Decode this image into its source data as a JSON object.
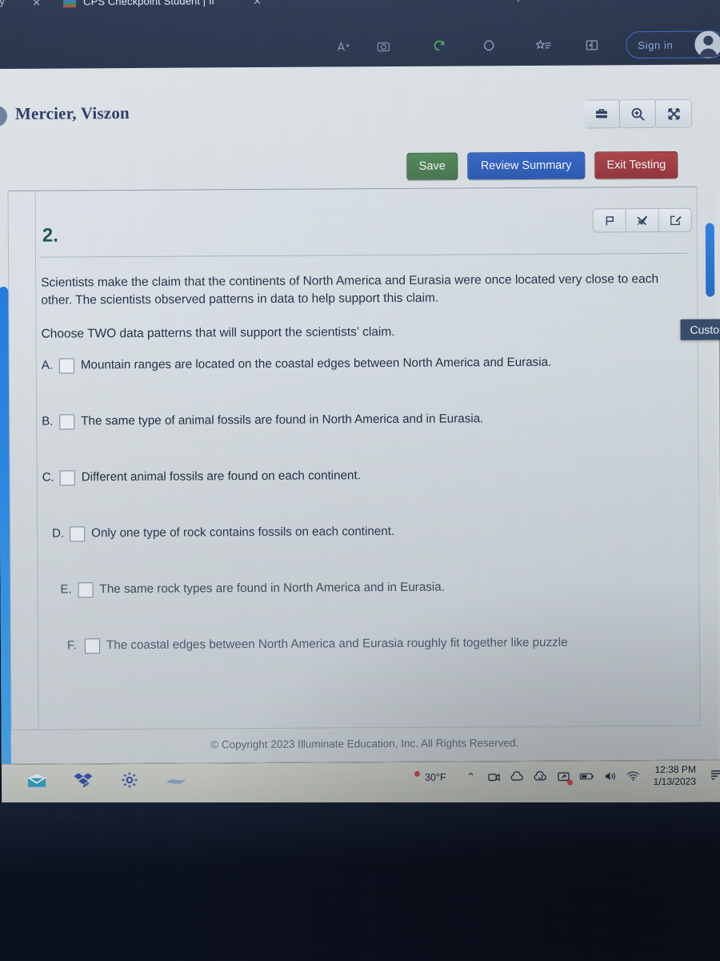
{
  "browser": {
    "tab_left_partial": "ty",
    "tab_left_close": "✕",
    "active_tab_title": "CPS Checkpoint Student | Il",
    "active_tab_close": "✕",
    "new_tab": "+",
    "favicon_name": "illuminate-favicon",
    "toolbar_icons": [
      {
        "name": "read-aloud-icon",
        "glyph": "A"
      },
      {
        "name": "collections-photo-icon",
        "glyph": ""
      },
      {
        "name": "refresh-green-icon",
        "glyph": ""
      },
      {
        "name": "browser-essentials-icon",
        "glyph": ""
      },
      {
        "name": "favorites-list-icon",
        "glyph": ""
      },
      {
        "name": "split-screen-icon",
        "glyph": ""
      }
    ],
    "signin_label": "Sign in",
    "profile_name": "profile-avatar"
  },
  "app": {
    "back_icon": "‹",
    "student_name": "Mercier, Viszon",
    "header_buttons": [
      {
        "name": "toolbox-button",
        "title": "Tools"
      },
      {
        "name": "zoom-in-button",
        "title": "Zoom In"
      },
      {
        "name": "fullscreen-button",
        "title": "Full Screen"
      }
    ],
    "actions": {
      "save_label": "Save",
      "review_label": "Review Summary",
      "exit_label": "Exit Testing",
      "save_color": "#44764a",
      "review_color": "#2a5cba",
      "exit_color": "#9c3539"
    }
  },
  "question": {
    "number": "2.",
    "number_color": "#1d5149",
    "toolbar_buttons": [
      {
        "name": "flag-question-button",
        "title": "Flag"
      },
      {
        "name": "eliminate-choice-button",
        "title": "Eliminate Choice"
      },
      {
        "name": "notepad-button",
        "title": "Notepad"
      }
    ],
    "stem_paragraph_1": "Scientists make the claim that the continents of North America and Eurasia were once located very close to each other. The scientists observed patterns in data to help support this claim.",
    "stem_paragraph_2": "Choose TWO data patterns that will support the scientists’ claim.",
    "options": [
      {
        "letter": "A.",
        "text": "Mountain ranges are located on the coastal edges between North America and Eurasia.",
        "checked": false
      },
      {
        "letter": "B.",
        "text": "The same type of animal fossils are found in North America and in Eurasia.",
        "checked": false
      },
      {
        "letter": "C.",
        "text": "Different animal fossils are found on each continent.",
        "checked": false
      },
      {
        "letter": "D.",
        "text": "Only one type of rock contains fossils on each continent.",
        "checked": false
      },
      {
        "letter": "E.",
        "text": "The same rock types are found in North America and in Eurasia.",
        "checked": false
      },
      {
        "letter": "F.",
        "text": "The coastal edges between North America and Eurasia roughly fit together like puzzle",
        "checked": false
      }
    ],
    "copyright": "© Copyright 2023 Illuminate Education, Inc. All Rights Reserved."
  },
  "overlay": {
    "customize_label": "Customize",
    "scrollbar_accent": "#2f7fe0"
  },
  "taskbar": {
    "left_icons": [
      {
        "name": "mail-icon"
      },
      {
        "name": "dropbox-icon"
      },
      {
        "name": "settings-gear-icon"
      },
      {
        "name": "unknown-blue-icon"
      }
    ],
    "tray": {
      "temperature": "30°F",
      "chevron": "⌃",
      "icons": [
        {
          "name": "camera-icon"
        },
        {
          "name": "cloud-icon"
        },
        {
          "name": "cloud-sync-icon"
        },
        {
          "name": "screen-cast-icon",
          "badge": true
        },
        {
          "name": "battery-icon"
        },
        {
          "name": "volume-icon"
        },
        {
          "name": "wifi-icon"
        }
      ],
      "time": "12:38 PM",
      "date": "1/13/2023",
      "notifications": "notifications-icon"
    }
  }
}
